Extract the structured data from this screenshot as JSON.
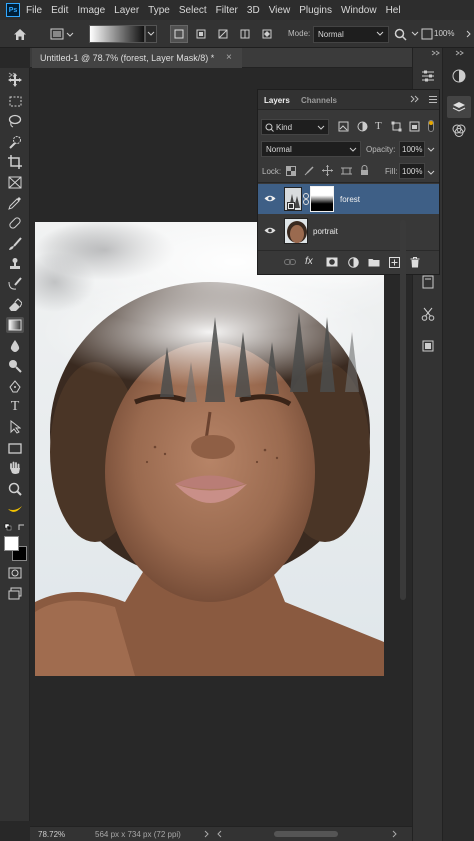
{
  "menu": {
    "items": [
      "File",
      "Edit",
      "Image",
      "Layer",
      "Type",
      "Select",
      "Filter",
      "3D",
      "View",
      "Plugins",
      "Window",
      "Hel"
    ],
    "app_badge": "Ps"
  },
  "options_bar": {
    "mode_label": "Mode:",
    "mode_value": "Normal",
    "zoom_value": "100%"
  },
  "document": {
    "tab_title": "Untitled-1 @ 78.7% (forest, Layer Mask/8) *",
    "close_glyph": "×",
    "zoom": "78.72%",
    "dimensions": "564 px x 734 px (72 ppi)"
  },
  "layers_panel": {
    "tabs": [
      "Layers",
      "Channels"
    ],
    "filter_kind": "Kind",
    "blend_mode": "Normal",
    "opacity_label": "Opacity:",
    "opacity_value": "100%",
    "lock_label": "Lock:",
    "fill_label": "Fill:",
    "fill_value": "100%",
    "layers": [
      {
        "name": "forest",
        "selected": true,
        "has_mask": true,
        "visible": true
      },
      {
        "name": "portrait",
        "selected": false,
        "has_mask": false,
        "visible": true
      }
    ],
    "footer_icons": [
      "link-icon",
      "fx-icon",
      "mask-icon",
      "adjustment-icon",
      "group-folder-icon",
      "new-layer-icon",
      "trash-icon"
    ],
    "fx_label": "fx"
  },
  "colors": {
    "app_bg": "#282828",
    "panel_bg": "#383838",
    "selected_layer": "#3e5f86",
    "accent": "#31a8ff"
  }
}
